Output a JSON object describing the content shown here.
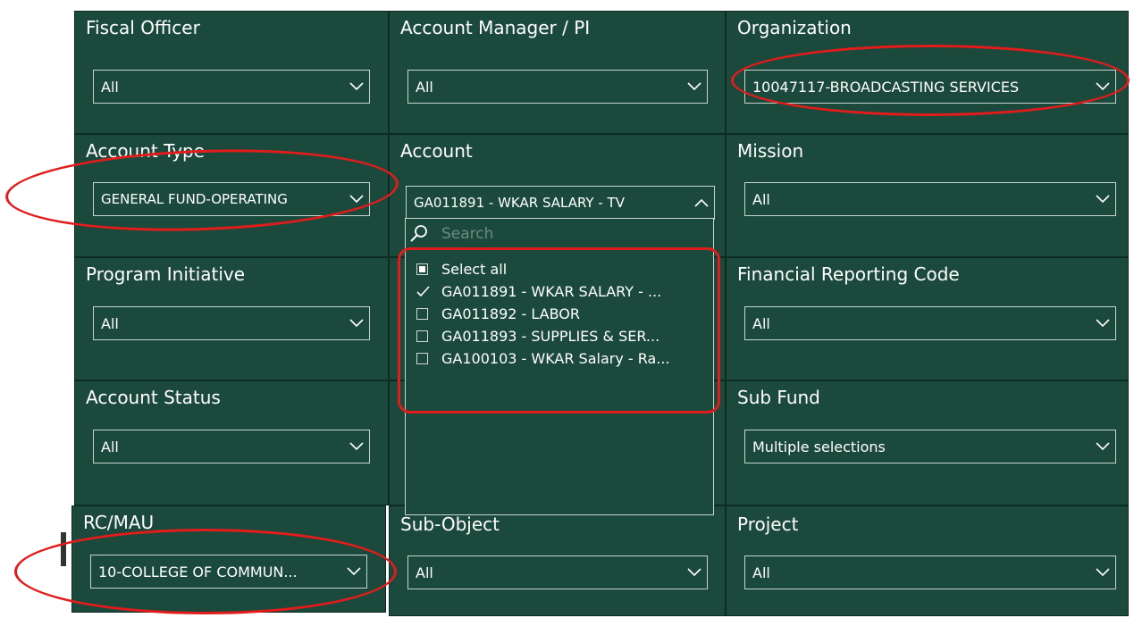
{
  "filters": {
    "fiscal_officer": {
      "title": "Fiscal Officer",
      "value": "All"
    },
    "account_manager": {
      "title": "Account Manager / PI",
      "value": "All"
    },
    "organization": {
      "title": "Organization",
      "value": "10047117-BROADCASTING SERVICES"
    },
    "account_type": {
      "title": "Account Type",
      "value": "GENERAL FUND-OPERATING"
    },
    "account": {
      "title": "Account",
      "value": "GA011891 - WKAR SALARY - TV"
    },
    "mission": {
      "title": "Mission",
      "value": "All"
    },
    "program_initiative": {
      "title": "Program Initiative",
      "value": "All"
    },
    "financial_reporting_code": {
      "title": "Financial Reporting Code",
      "value": "All"
    },
    "account_status": {
      "title": "Account Status",
      "value": "All"
    },
    "sub_fund": {
      "title": "Sub Fund",
      "value": "Multiple selections"
    },
    "rc_mau": {
      "title": "RC/MAU",
      "value": "10-COLLEGE OF COMMUN..."
    },
    "sub_object": {
      "title": "Sub-Object",
      "value": "All"
    },
    "project": {
      "title": "Project",
      "value": "All"
    }
  },
  "account_dropdown": {
    "search_placeholder": "Search",
    "select_all_label": "Select all",
    "items": [
      {
        "label": "GA011891 - WKAR SALARY - ...",
        "checked": true
      },
      {
        "label": "GA011892 - LABOR",
        "checked": false
      },
      {
        "label": "GA011893 - SUPPLIES & SER...",
        "checked": false
      },
      {
        "label": "GA100103 - WKAR Salary - Ra...",
        "checked": false
      }
    ]
  },
  "colors": {
    "tile_bg": "#1b4a3d",
    "annotation": "#e21b1b",
    "text": "#ffffff"
  },
  "icons": {
    "dropdown": "chevron-down-icon",
    "open": "chevron-up-icon",
    "search": "search-icon",
    "check": "checkmark-icon"
  }
}
